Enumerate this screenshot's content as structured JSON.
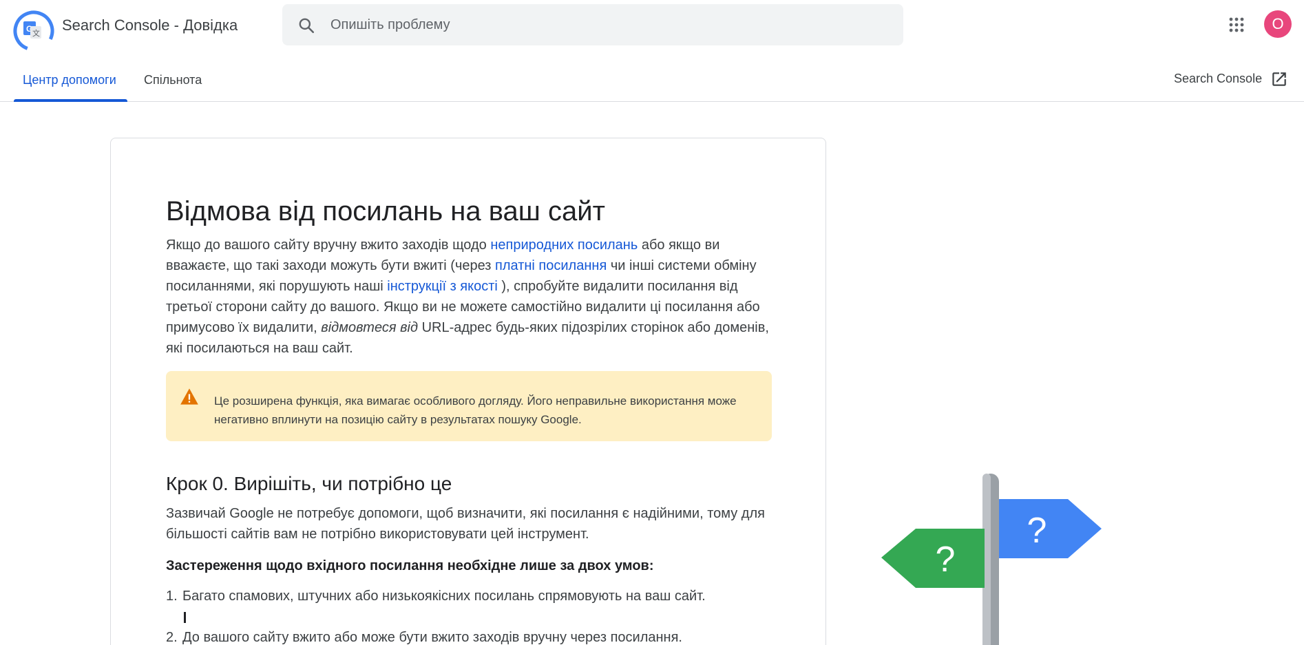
{
  "header": {
    "app_title": "Search Console - Довідка",
    "search_placeholder": "Опишіть проблему",
    "avatar_letter": "О",
    "icons": [
      "google-help-logo-icon",
      "search-icon",
      "apps-grid-icon"
    ]
  },
  "tabs": {
    "items": [
      {
        "label": "Центр допомоги",
        "active": true
      },
      {
        "label": "Спільнота",
        "active": false
      }
    ],
    "console_link": "Search Console",
    "console_icon": "open-in-new-icon"
  },
  "article": {
    "title": "Відмова від посилань на ваш сайт",
    "intro": {
      "t1": "Якщо до вашого сайту вручну вжито заходів щодо ",
      "link1": "неприродних посилань",
      "t2": " або якщо ви вважаєте, що такі заходи можуть бути вжиті (через ",
      "link2": "платні посилання",
      "t3": " чи інші системи обміну посиланнями, які порушують наші ",
      "link3": "інструкції з якості",
      "t4": " ), спробуйте видалити посилання від третьої сторони сайту до вашого. Якщо ви не можете самостійно видалити ці посилання або примусово їх видалити, ",
      "em1": "відмовтеся від",
      "t5": "  URL-адрес будь-яких підозрілих сторінок або доменів, які посилаються на ваш сайт."
    },
    "warning": "Це розширена функція, яка вимагає особливого догляду. Його неправильне використання може негативно вплинути на позицію сайту в результатах пошуку Google.",
    "warning_color": "#feefc3",
    "step0_title": "Крок 0. Вирішіть, чи потрібно це",
    "step0_text": "Зазвичай Google не потребує допомоги, щоб визначити, які посилання є надійними, тому для більшості сайтів вам не потрібно використовувати цей інструмент.",
    "conditions_title": "Застереження щодо вхідного посилання необхідне лише за двох умов:",
    "conditions": [
      {
        "num": "1.",
        "text": "Багато спамових, штучних або низькоякісних посилань спрямовують на ваш сайт."
      },
      {
        "num": "2.",
        "text": "До вашого сайту вжито або може бути вжито заходів вручну через посилання."
      }
    ]
  },
  "illustration": {
    "left_sign": "?",
    "right_sign": "?",
    "left_color": "#34a853",
    "right_color": "#4285f4"
  },
  "colors": {
    "accent": "#1558d6",
    "avatar": "#e8467c",
    "warning_icon": "#e37400"
  }
}
